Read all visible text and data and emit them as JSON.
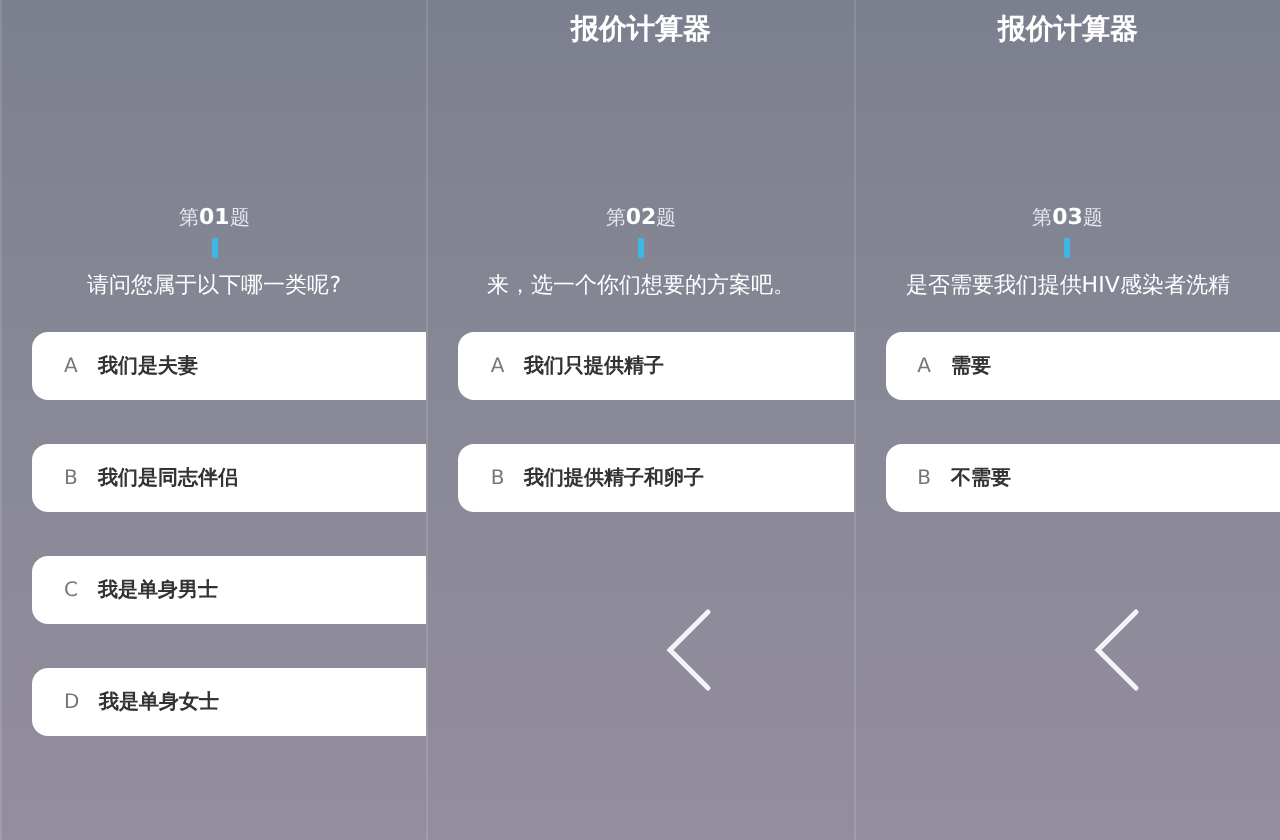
{
  "panels": [
    {
      "number": "第**01**题",
      "question": "请问您属于以下哪一类呢?",
      "options": [
        {
          "letter": "A",
          "text": "我们是夫妻"
        },
        {
          "letter": "B",
          "text": "我们是同志伴侣"
        },
        {
          "letter": "C",
          "text": "我是单身男士"
        },
        {
          "letter": "D",
          "text": "我是单身女士"
        }
      ],
      "back_button": false
    },
    {
      "title": "报价计算器",
      "number": "第**02**题",
      "question": "来，选一个你们想要的方案吧。",
      "options": [
        {
          "letter": "A",
          "text": "我们只提供精子"
        },
        {
          "letter": "B",
          "text": "我们提供精子和卵子"
        }
      ],
      "back_button": true
    },
    {
      "title": "报价计算器",
      "number": "第**03**题",
      "question": "是否需要我们提供HIV感染者洗精",
      "options": [
        {
          "letter": "A",
          "text": "需要"
        },
        {
          "letter": "B",
          "text": "不需要"
        }
      ],
      "back_button": true
    }
  ]
}
